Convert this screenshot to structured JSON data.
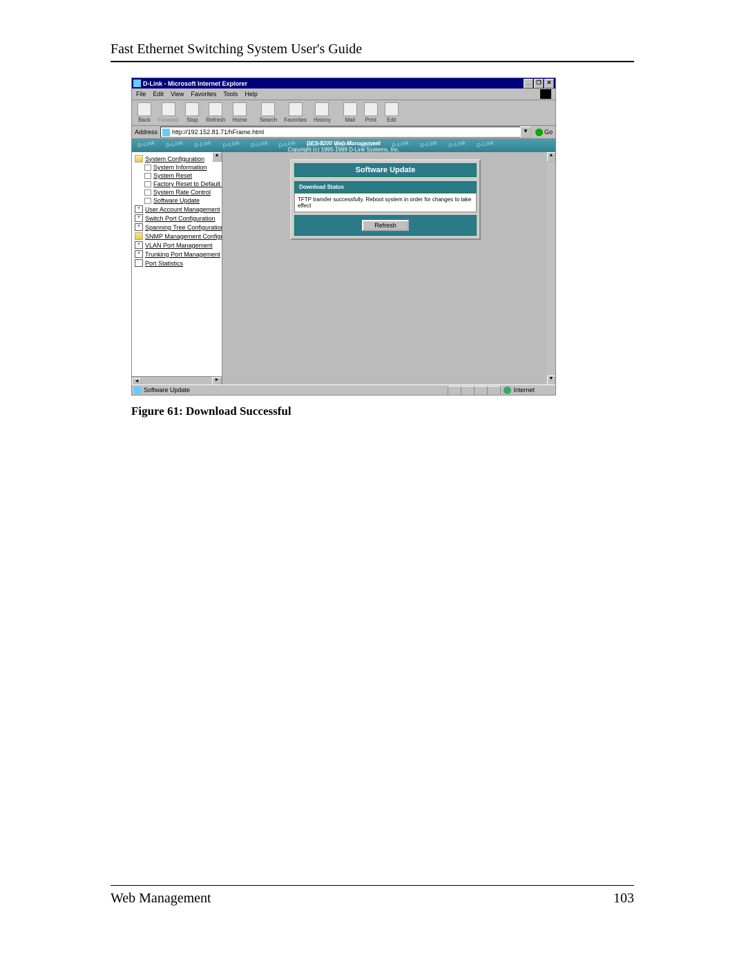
{
  "doc": {
    "header": "Fast Ethernet Switching System User's Guide",
    "caption": "Figure 61: Download Successful",
    "footer_left": "Web Management",
    "footer_right": "103"
  },
  "window": {
    "title": "D-Link - Microsoft Internet Explorer",
    "min": "_",
    "max": "❐",
    "close": "✕"
  },
  "menu": {
    "file": "File",
    "edit": "Edit",
    "view": "View",
    "fav": "Favorites",
    "tools": "Tools",
    "help": "Help"
  },
  "toolbar": {
    "back": "Back",
    "forward": "Forward",
    "stop": "Stop",
    "refresh": "Refresh",
    "home": "Home",
    "search": "Search",
    "favorites": "Favorites",
    "history": "History",
    "mail": "Mail",
    "print": "Print",
    "edit": "Edit"
  },
  "address": {
    "label": "Address",
    "value": "http://192.152.81.71/hFrame.html",
    "drop": "▼",
    "go": "Go"
  },
  "banner": {
    "watermark": "D-Link",
    "line1": "DES-5200 Web Management",
    "line2": "Copyright (c) 1995-1999 D-Link Systems, Inc."
  },
  "tree": {
    "sysconf": "System Configuration",
    "items": [
      "System Information",
      "System Reset",
      "Factory Reset to Default Confi",
      "System Rate Control",
      "Software Update"
    ],
    "rest": [
      "User Account Management",
      "Switch Port Configuration",
      "Spanning Tree Configuration",
      "SNMP Management Configuration",
      "VLAN Port Management",
      "Trunking Port Management",
      "Port Statistics"
    ],
    "plus": "+",
    "dot": "·"
  },
  "card": {
    "title": "Software Update",
    "sub": "Download Status",
    "msg": "TFTP transfer successfully. Reboot system in order for changes to take effect",
    "refresh": "Refresh"
  },
  "status": {
    "text": "Software Update",
    "zone": "Internet"
  }
}
